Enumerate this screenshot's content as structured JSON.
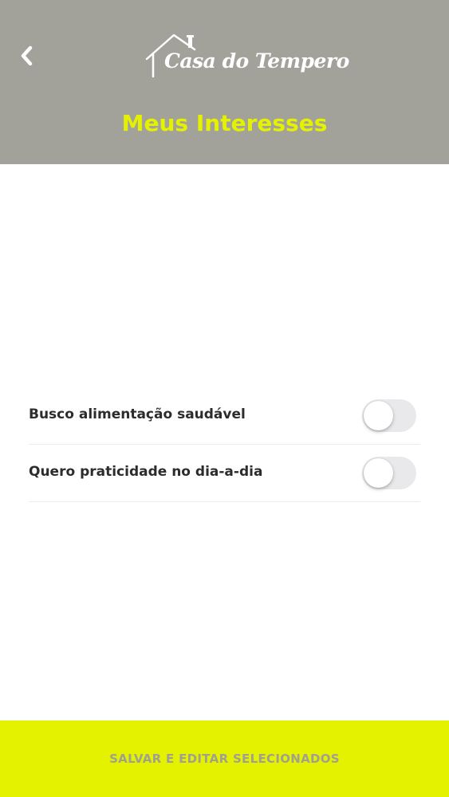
{
  "header": {
    "back_icon": "chevron-left-icon",
    "logo_text": "Casa do Tempero",
    "title": "Meus Interesses",
    "background_color": "#a2a19a",
    "title_color": "#e4f200"
  },
  "interests": [
    {
      "label": "Busco alimentação saudável",
      "enabled": false
    },
    {
      "label": "Quero praticidade no dia-a-dia",
      "enabled": false
    }
  ],
  "footer": {
    "save_label": "SALVAR E EDITAR SELECIONADOS",
    "background_color": "#e4f200"
  }
}
